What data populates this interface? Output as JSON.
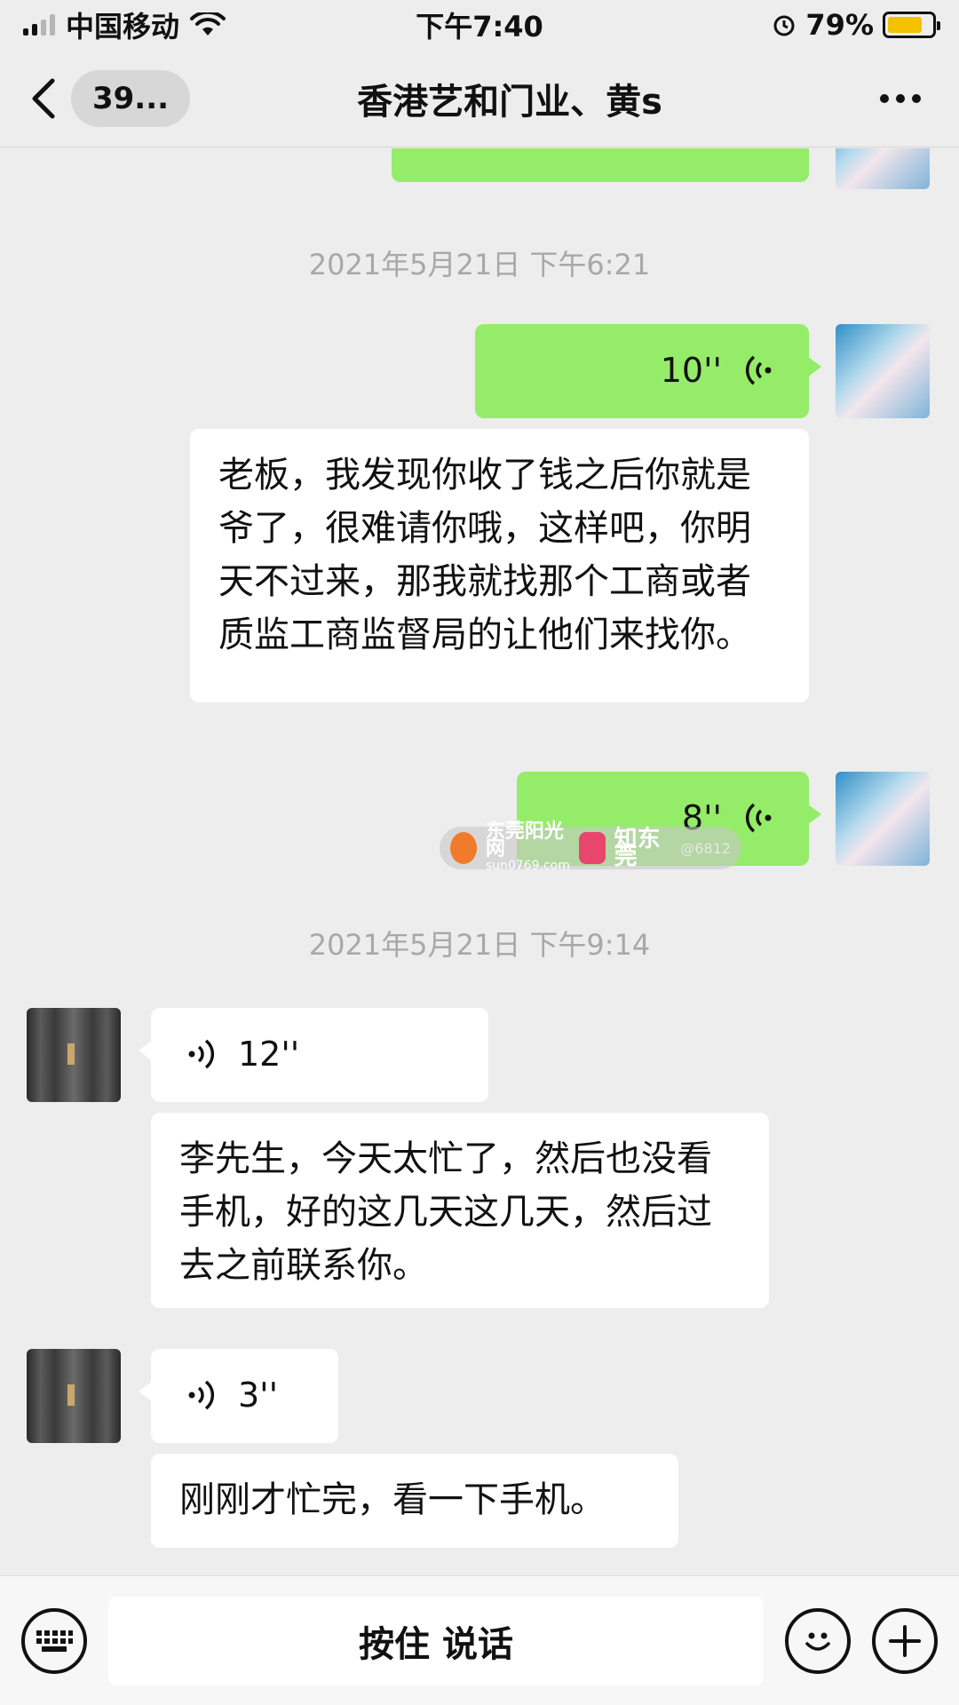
{
  "status_bar": {
    "carrier": "中国移动",
    "time": "下午7:40",
    "battery": "79%",
    "battery_level": 0.79
  },
  "nav": {
    "unread": "39...",
    "title": "香港艺和门业、黄s"
  },
  "messages": [
    {
      "id": "ts1",
      "type": "timestamp",
      "text": "2021年5月21日 下午6:21"
    },
    {
      "id": "m1",
      "from": "me",
      "type": "voice",
      "duration": "10''"
    },
    {
      "id": "m2",
      "from": "me",
      "type": "text",
      "text": "老板，我发现你收了钱之后你就是爷了，很难请你哦，这样吧，你明天不过来，那我就找那个工商或者质监工商监督局的让他们来找你。"
    },
    {
      "id": "m3",
      "from": "me",
      "type": "voice",
      "duration": "8''"
    },
    {
      "id": "ts2",
      "type": "timestamp",
      "text": "2021年5月21日 下午9:14"
    },
    {
      "id": "m4",
      "from": "other",
      "type": "voice",
      "duration": "12''"
    },
    {
      "id": "m5",
      "from": "other",
      "type": "text",
      "text": "李先生，今天太忙了，然后也没看手机，好的这几天这几天，然后过去之前联系你。"
    },
    {
      "id": "m6",
      "from": "other",
      "type": "voice",
      "duration": "3''"
    },
    {
      "id": "m7",
      "from": "other",
      "type": "text",
      "text": "刚刚才忙完，看一下手机。"
    }
  ],
  "watermark": {
    "brand1": "东莞阳光网",
    "brand1_sub": "sun0769.com",
    "brand2": "知东莞",
    "handle": "@6812"
  },
  "input_bar": {
    "hold_to_talk": "按住 说话"
  },
  "colors": {
    "my_bubble": "#95ec69",
    "their_bubble": "#ffffff",
    "background": "#ededed"
  }
}
